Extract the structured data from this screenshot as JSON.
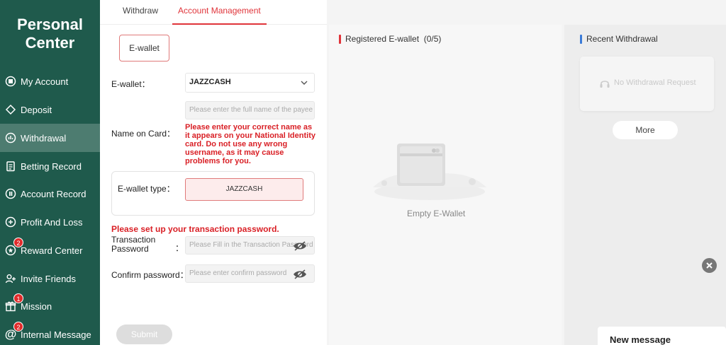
{
  "sidebar": {
    "title_line1": "Personal",
    "title_line2": "Center",
    "items": [
      {
        "label": "My Account",
        "icon": "account-icon",
        "badge": ""
      },
      {
        "label": "Deposit",
        "icon": "deposit-icon",
        "badge": ""
      },
      {
        "label": "Withdrawal",
        "icon": "withdrawal-icon",
        "badge": "",
        "active": true
      },
      {
        "label": "Betting Record",
        "icon": "clipboard-icon",
        "badge": ""
      },
      {
        "label": "Account Record",
        "icon": "record-icon",
        "badge": ""
      },
      {
        "label": "Profit And Loss",
        "icon": "profit-icon",
        "badge": ""
      },
      {
        "label": "Reward Center",
        "icon": "reward-icon",
        "badge": "2"
      },
      {
        "label": "Invite Friends",
        "icon": "invite-icon",
        "badge": ""
      },
      {
        "label": "Mission",
        "icon": "gift-icon",
        "badge": "1"
      },
      {
        "label": "Internal Message",
        "icon": "at-icon",
        "badge": "2"
      }
    ]
  },
  "tabs": {
    "withdraw": "Withdraw",
    "account_management": "Account Management"
  },
  "form": {
    "ewallet_tab": "E-wallet",
    "ewallet_label": "E-wallet：",
    "ewallet_value": "JAZZCASH",
    "name_label": "Name on Card：",
    "name_placeholder": "Please enter the full name of the payee",
    "name_warning": "Please enter your correct name as it appears on your National Identity card. Do not use any wrong username, as it may cause problems for you.",
    "type_label": "E-wallet type：",
    "type_value": "JAZZCASH",
    "password_warning": "Please set up your transaction password.",
    "tx_password_label_1": "Transaction",
    "tx_password_label_2": "Password",
    "tx_password_colon": "：",
    "tx_password_placeholder": "Please Fill in the Transaction Password",
    "confirm_label": "Confirm password：",
    "confirm_placeholder": "Please enter confirm password",
    "submit": "Submit"
  },
  "registered": {
    "title": "Registered E-wallet",
    "count": "(0/5)",
    "empty": "Empty E-Wallet"
  },
  "recent": {
    "title": "Recent Withdrawal",
    "empty": "No Withdrawal Request",
    "more": "More"
  },
  "chat": {
    "new_message": "New message"
  },
  "colors": {
    "sidebar_bg": "#1f5a4c",
    "active_item": "#4d7c70",
    "accent_red": "#e0343a",
    "accent_blue": "#3b7bd8"
  }
}
